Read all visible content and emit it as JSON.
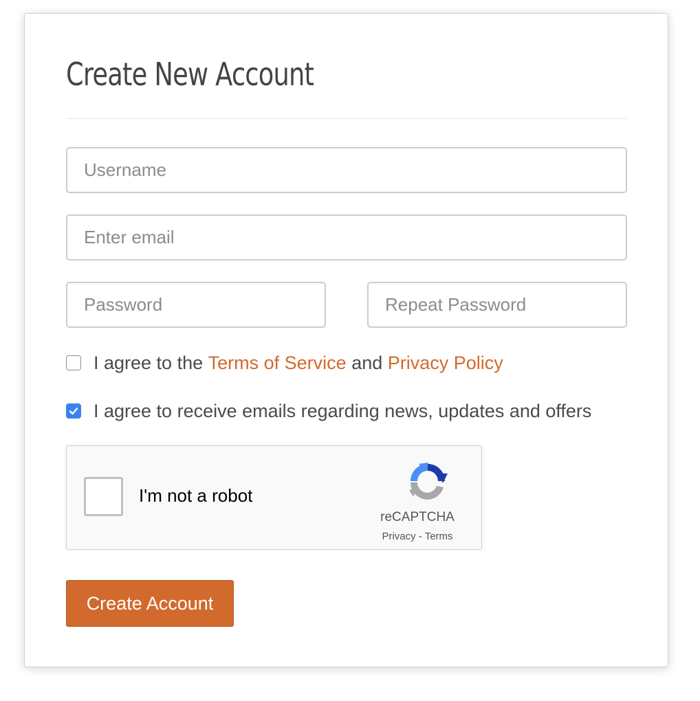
{
  "form": {
    "title": "Create New Account",
    "fields": {
      "username": {
        "placeholder": "Username",
        "value": ""
      },
      "email": {
        "placeholder": "Enter email",
        "value": ""
      },
      "password": {
        "placeholder": "Password",
        "value": ""
      },
      "repeat_password": {
        "placeholder": "Repeat Password",
        "value": ""
      }
    },
    "terms": {
      "checked": false,
      "prefix": "I agree to the ",
      "terms_link": "Terms of Service",
      "middle": " and ",
      "privacy_link": "Privacy Policy"
    },
    "emails_opt_in": {
      "checked": true,
      "label": "I agree to receive emails regarding news, updates and offers"
    },
    "recaptcha": {
      "label": "I'm not a robot",
      "checked": false,
      "brand": "reCAPTCHA",
      "privacy_link": "Privacy",
      "separator": " - ",
      "terms_link": "Terms",
      "icon": "recaptcha-logo-icon"
    },
    "submit_label": "Create Account"
  },
  "colors": {
    "accent": "#d2692d",
    "checkbox_checked": "#3b82f0",
    "title_text": "#444444",
    "body_text": "#4a4a4a"
  }
}
